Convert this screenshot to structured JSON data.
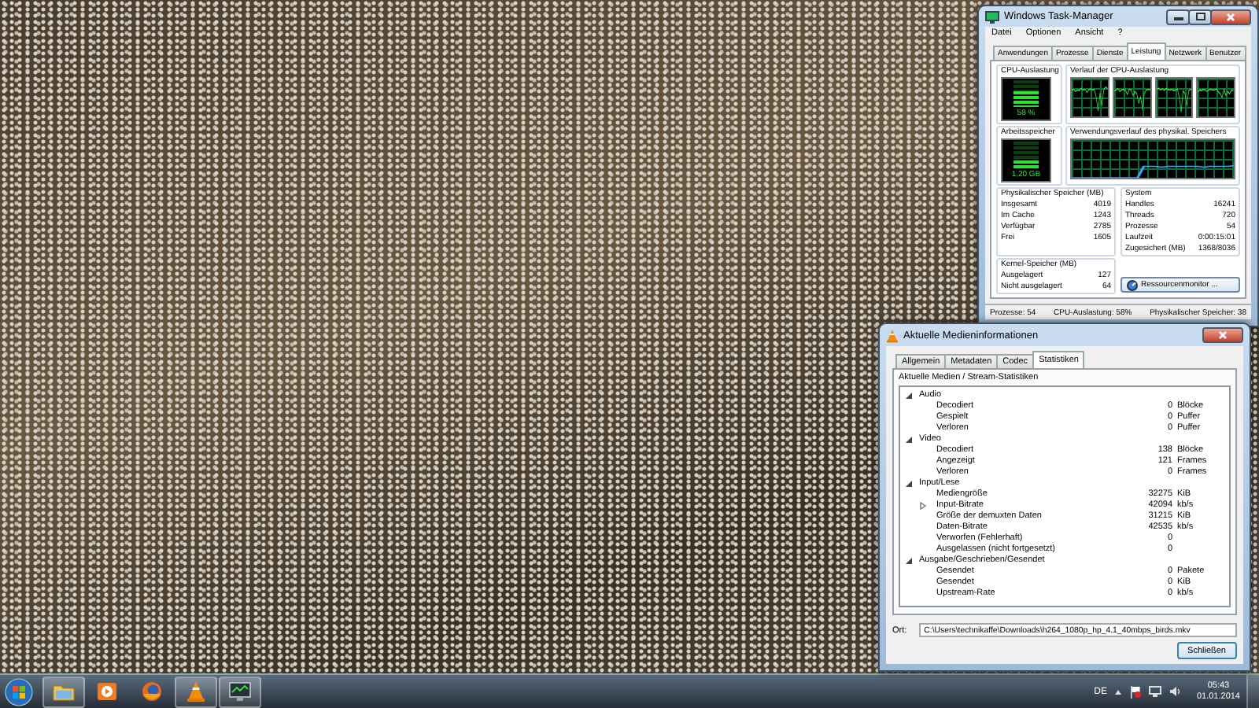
{
  "task_manager": {
    "title": "Windows Task-Manager",
    "menu": [
      "Datei",
      "Optionen",
      "Ansicht",
      "?"
    ],
    "tabs": [
      {
        "label": "Anwendungen",
        "selected": false
      },
      {
        "label": "Prozesse",
        "selected": false
      },
      {
        "label": "Dienste",
        "selected": false
      },
      {
        "label": "Leistung",
        "selected": true
      },
      {
        "label": "Netzwerk",
        "selected": false
      },
      {
        "label": "Benutzer",
        "selected": false
      }
    ],
    "cpu_usage": {
      "label": "CPU-Auslastung",
      "level": 0.58,
      "reading": "58 %"
    },
    "cpu_history": {
      "label": "Verlauf der CPU-Auslastung"
    },
    "memory": {
      "label": "Arbeitsspeicher",
      "level": 0.3,
      "reading": "1,20 GB"
    },
    "memory_history": {
      "label": "Verwendungsverlauf des physikal. Speichers"
    },
    "physical_memory": {
      "title": "Physikalischer Speicher (MB)",
      "rows": [
        {
          "label": "Insgesamt",
          "value": "4019"
        },
        {
          "label": "Im Cache",
          "value": "1243"
        },
        {
          "label": "Verfügbar",
          "value": "2785"
        },
        {
          "label": "Frei",
          "value": "1605"
        }
      ]
    },
    "system": {
      "title": "System",
      "rows": [
        {
          "label": "Handles",
          "value": "16241"
        },
        {
          "label": "Threads",
          "value": "720"
        },
        {
          "label": "Prozesse",
          "value": "54"
        },
        {
          "label": "Laufzeit",
          "value": "0:00:15:01"
        },
        {
          "label": "Zugesichert (MB)",
          "value": "1368/8036"
        }
      ]
    },
    "kernel_memory": {
      "title": "Kernel-Speicher (MB)",
      "rows": [
        {
          "label": "Ausgelagert",
          "value": "127"
        },
        {
          "label": "Nicht ausgelagert",
          "value": "64"
        }
      ]
    },
    "resource_monitor_button": "Ressourcenmonitor ...",
    "status_bar": [
      "Prozesse: 54",
      "CPU-Auslastung: 58%",
      "Physikalischer Speicher: 38"
    ]
  },
  "media_info": {
    "title": "Aktuelle Medieninformationen",
    "tabs": [
      {
        "label": "Allgemein",
        "selected": false
      },
      {
        "label": "Metadaten",
        "selected": false
      },
      {
        "label": "Codec",
        "selected": false
      },
      {
        "label": "Statistiken",
        "selected": true
      }
    ],
    "heading": "Aktuelle Medien / Stream-Statistiken",
    "tree": [
      {
        "label": "Audio",
        "expanded": true,
        "children": [
          {
            "label": "Decodiert",
            "value": "0",
            "unit": "Blöcke"
          },
          {
            "label": "Gespielt",
            "value": "0",
            "unit": "Puffer"
          },
          {
            "label": "Verloren",
            "value": "0",
            "unit": "Puffer"
          }
        ]
      },
      {
        "label": "Video",
        "expanded": true,
        "children": [
          {
            "label": "Decodiert",
            "value": "138",
            "unit": "Blöcke"
          },
          {
            "label": "Angezeigt",
            "value": "121",
            "unit": "Frames"
          },
          {
            "label": "Verloren",
            "value": "0",
            "unit": "Frames"
          }
        ]
      },
      {
        "label": "Input/Lese",
        "expanded": true,
        "children": [
          {
            "label": "Mediengröße",
            "value": "32275",
            "unit": "KiB"
          },
          {
            "label": "Input-Bitrate",
            "value": "42094",
            "unit": "kb/s",
            "expanded": false
          },
          {
            "label": "Größe der demuxten Daten",
            "value": "31215",
            "unit": "KiB"
          },
          {
            "label": "Daten-Bitrate",
            "value": "42535",
            "unit": "kb/s"
          },
          {
            "label": "Verworfen (Fehlerhaft)",
            "value": "0"
          },
          {
            "label": "Ausgelassen (nicht fortgesetzt)",
            "value": "0"
          }
        ]
      },
      {
        "label": "Ausgabe/Geschrieben/Gesendet",
        "expanded": true,
        "children": [
          {
            "label": "Gesendet",
            "value": "0",
            "unit": "Pakete"
          },
          {
            "label": "Gesendet",
            "value": "0",
            "unit": "KiB"
          },
          {
            "label": "Upstream-Rate",
            "value": "0",
            "unit": "kb/s"
          }
        ]
      }
    ],
    "location_label": "Ort:",
    "location": "C:\\Users\\technikaffe\\Downloads\\h264_1080p_hp_4.1_40mbps_birds.mkv",
    "close_button": "Schließen"
  },
  "taskbar": {
    "apps": [
      {
        "kind": "folder",
        "running": true
      },
      {
        "kind": "player",
        "running": false
      },
      {
        "kind": "browser",
        "running": false
      },
      {
        "kind": "cone",
        "running": true
      },
      {
        "kind": "monitor",
        "running": true
      }
    ],
    "language": "DE",
    "time": "05:43",
    "date": "01.01.2014"
  }
}
